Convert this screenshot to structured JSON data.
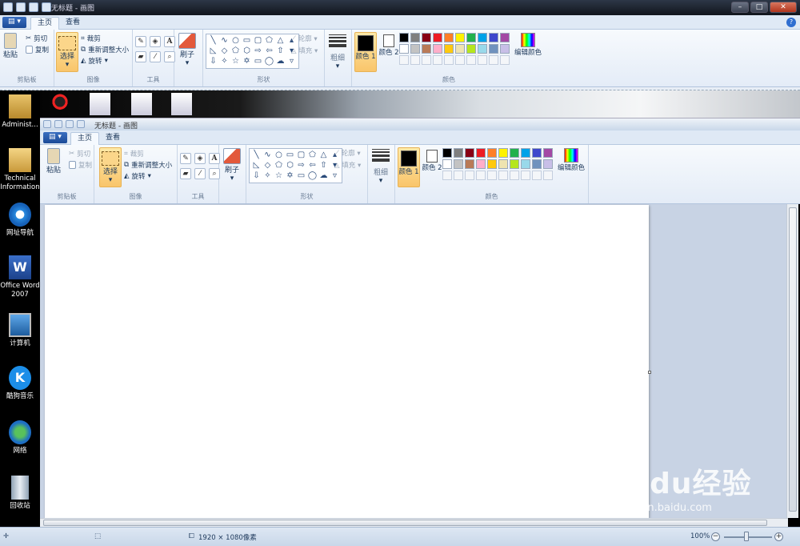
{
  "outer_window": {
    "title": "无标题 - 画图",
    "tabs": [
      "主页",
      "查看"
    ],
    "help": "?"
  },
  "inner_window": {
    "title": "无标题 - 画图",
    "tabs": [
      "主页",
      "查看"
    ]
  },
  "ribbon": {
    "clipboard": {
      "group": "剪贴板",
      "paste": "粘贴",
      "cut": "剪切",
      "copy": "复制"
    },
    "image": {
      "group": "图像",
      "select": "选择",
      "crop": "裁剪",
      "resize": "重新调整大小",
      "rotate": "旋转"
    },
    "tools": {
      "group": "工具"
    },
    "brush": {
      "label": "刷子"
    },
    "shapes": {
      "group": "形状",
      "outline": "轮廓",
      "fill": "填充"
    },
    "size": {
      "label": "粗细"
    },
    "colors": {
      "group": "颜色",
      "color1": "颜色 1",
      "color2": "颜色 2",
      "edit": "编辑颜色",
      "color1_value": "#000000",
      "color2_value": "#ffffff",
      "row1": [
        "#000000",
        "#7f7f7f",
        "#880015",
        "#ed1c24",
        "#ff7f27",
        "#fff200",
        "#22b14c",
        "#00a2e8",
        "#3f48cc",
        "#a349a4"
      ],
      "row2": [
        "#ffffff",
        "#c3c3c3",
        "#b97a57",
        "#ffaec9",
        "#ffc90e",
        "#efe4b0",
        "#b5e61d",
        "#99d9ea",
        "#7092be",
        "#c8bfe7"
      ]
    }
  },
  "desktop_icons": [
    {
      "label": "Administ...",
      "icon": "user-folder-icon"
    },
    {
      "label": "Technical Information",
      "icon": "folder-icon"
    },
    {
      "label": "网址导航",
      "icon": "ie-icon"
    },
    {
      "label": "Office Word 2007",
      "icon": "word-icon"
    },
    {
      "label": "计算机",
      "icon": "computer-icon"
    },
    {
      "label": "酷狗音乐",
      "icon": "kugou-icon"
    },
    {
      "label": "网络",
      "icon": "network-icon"
    },
    {
      "label": "回收站",
      "icon": "recycle-bin-icon"
    }
  ],
  "status": {
    "dimensions": "1920 × 1080像素",
    "zoom": "100%"
  },
  "watermark": {
    "logo": "Baidu经验",
    "url": "jingyan.baidu.com"
  }
}
